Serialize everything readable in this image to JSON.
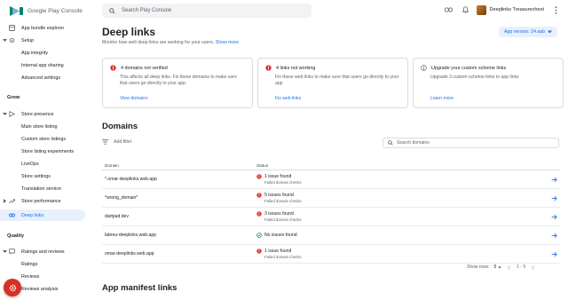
{
  "header": {
    "app_name": "Google Play Console",
    "search_placeholder": "Search Play Console",
    "account_name": "Deeplinks Treasurechest"
  },
  "sidebar": {
    "items_top": [
      {
        "label": "App bundle explorer"
      },
      {
        "label": "Setup"
      },
      {
        "label": "App integrity"
      },
      {
        "label": "Internal app sharing"
      },
      {
        "label": "Advanced settings"
      }
    ],
    "grow_title": "Grow",
    "grow_items": [
      {
        "label": "Store presence"
      },
      {
        "label": "Main store listing"
      },
      {
        "label": "Custom store listings"
      },
      {
        "label": "Store listing experiments"
      },
      {
        "label": "LiveOps"
      },
      {
        "label": "Store settings"
      },
      {
        "label": "Translation service"
      },
      {
        "label": "Store performance"
      },
      {
        "label": "Deep links"
      }
    ],
    "quality_title": "Quality",
    "quality_items": [
      {
        "label": "Ratings and reviews"
      },
      {
        "label": "Ratings"
      },
      {
        "label": "Reviews"
      },
      {
        "label": "Reviews analysis"
      }
    ]
  },
  "page": {
    "title": "Deep links",
    "subtitle": "Monitor how well deep links are working for your users.",
    "show_more": "Show more",
    "app_version": "App version: 24.aab"
  },
  "cards": [
    {
      "title": "4 domains not verified",
      "body": "This affects all deep links. Fix these domains to make sure that users go directly to your app.",
      "link": "View domains",
      "icon_color": "#d93025"
    },
    {
      "title": "4 links not working",
      "body": "Fix these web links to make sure that users go directly to your app",
      "link": "Fix web links",
      "icon_color": "#d93025"
    },
    {
      "title": "Upgrade your custom scheme links",
      "body": "Upgrade 3 custom scheme links to app links",
      "link": "Learn more",
      "icon_color": "#5f6368"
    }
  ],
  "domains": {
    "title": "Domains",
    "add_filter": "Add filter",
    "search_placeholder": "Search domains",
    "columns": {
      "domain": "Domain",
      "status": "Status"
    },
    "rows": [
      {
        "domain": "*.omar-deeplinks.web.app",
        "status": "1 issue found",
        "sub": "Failed domain checks",
        "ok": false
      },
      {
        "domain": "*wrong_domain*",
        "status": "5 issues found",
        "sub": "Failed domain checks",
        "ok": false
      },
      {
        "domain": "dartpad.dev",
        "status": "3 issues found",
        "sub": "Failed domain checks",
        "ok": false
      },
      {
        "domain": "labreu-deeplinks.web.app",
        "status": "No issues found",
        "sub": "",
        "ok": true
      },
      {
        "domain": "omar-deeplinks.web.app",
        "status": "1 issue found",
        "sub": "Failed domain checks",
        "ok": false
      }
    ],
    "pager": {
      "label": "Show rows",
      "rows": "5",
      "range": "1 - 5"
    }
  },
  "manifest": {
    "title": "App manifest links"
  },
  "colors": {
    "accent": "#1a73e8",
    "error": "#d93025",
    "ok": "#188038"
  }
}
